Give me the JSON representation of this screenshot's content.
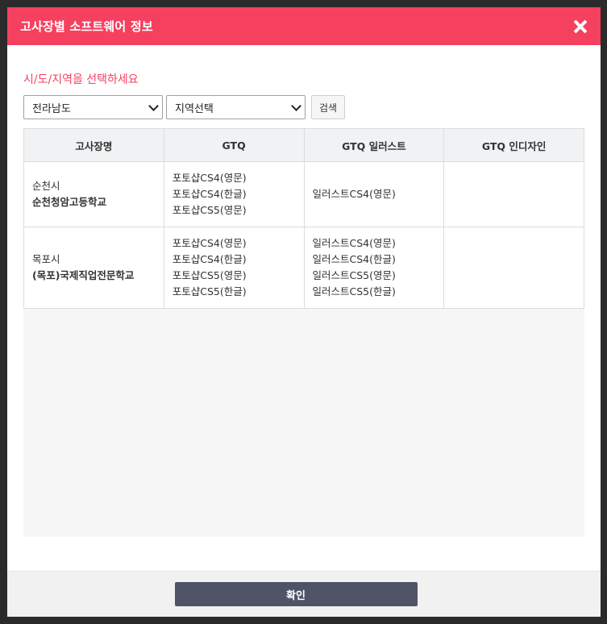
{
  "modal": {
    "title": "고사장별 소프트웨어 정보",
    "close_icon": "close-icon"
  },
  "filter": {
    "prompt": "시/도/지역을 선택하세요",
    "province_value": "전라남도",
    "region_value": "지역선택",
    "search_label": "검색"
  },
  "table": {
    "headers": [
      "고사장명",
      "GTQ",
      "GTQ 일러스트",
      "GTQ 인디자인"
    ],
    "rows": [
      {
        "city": "순천시",
        "school": "순천청암고등학교",
        "gtq": [
          "포토샵CS4(영문)",
          "포토샵CS4(한글)",
          "포토샵CS5(영문)"
        ],
        "illust": [
          "일러스트CS4(영문)"
        ],
        "indesign": []
      },
      {
        "city": "목포시",
        "school": "(목포)국제직업전문학교",
        "gtq": [
          "포토샵CS4(영문)",
          "포토샵CS4(한글)",
          "포토샵CS5(영문)",
          "포토샵CS5(한글)"
        ],
        "illust": [
          "일러스트CS4(영문)",
          "일러스트CS4(한글)",
          "일러스트CS5(영문)",
          "일러스트CS5(한글)"
        ],
        "indesign": []
      }
    ]
  },
  "footer": {
    "confirm_label": "확인"
  },
  "colors": {
    "header": "#f5405f",
    "confirm": "#4f5466"
  }
}
